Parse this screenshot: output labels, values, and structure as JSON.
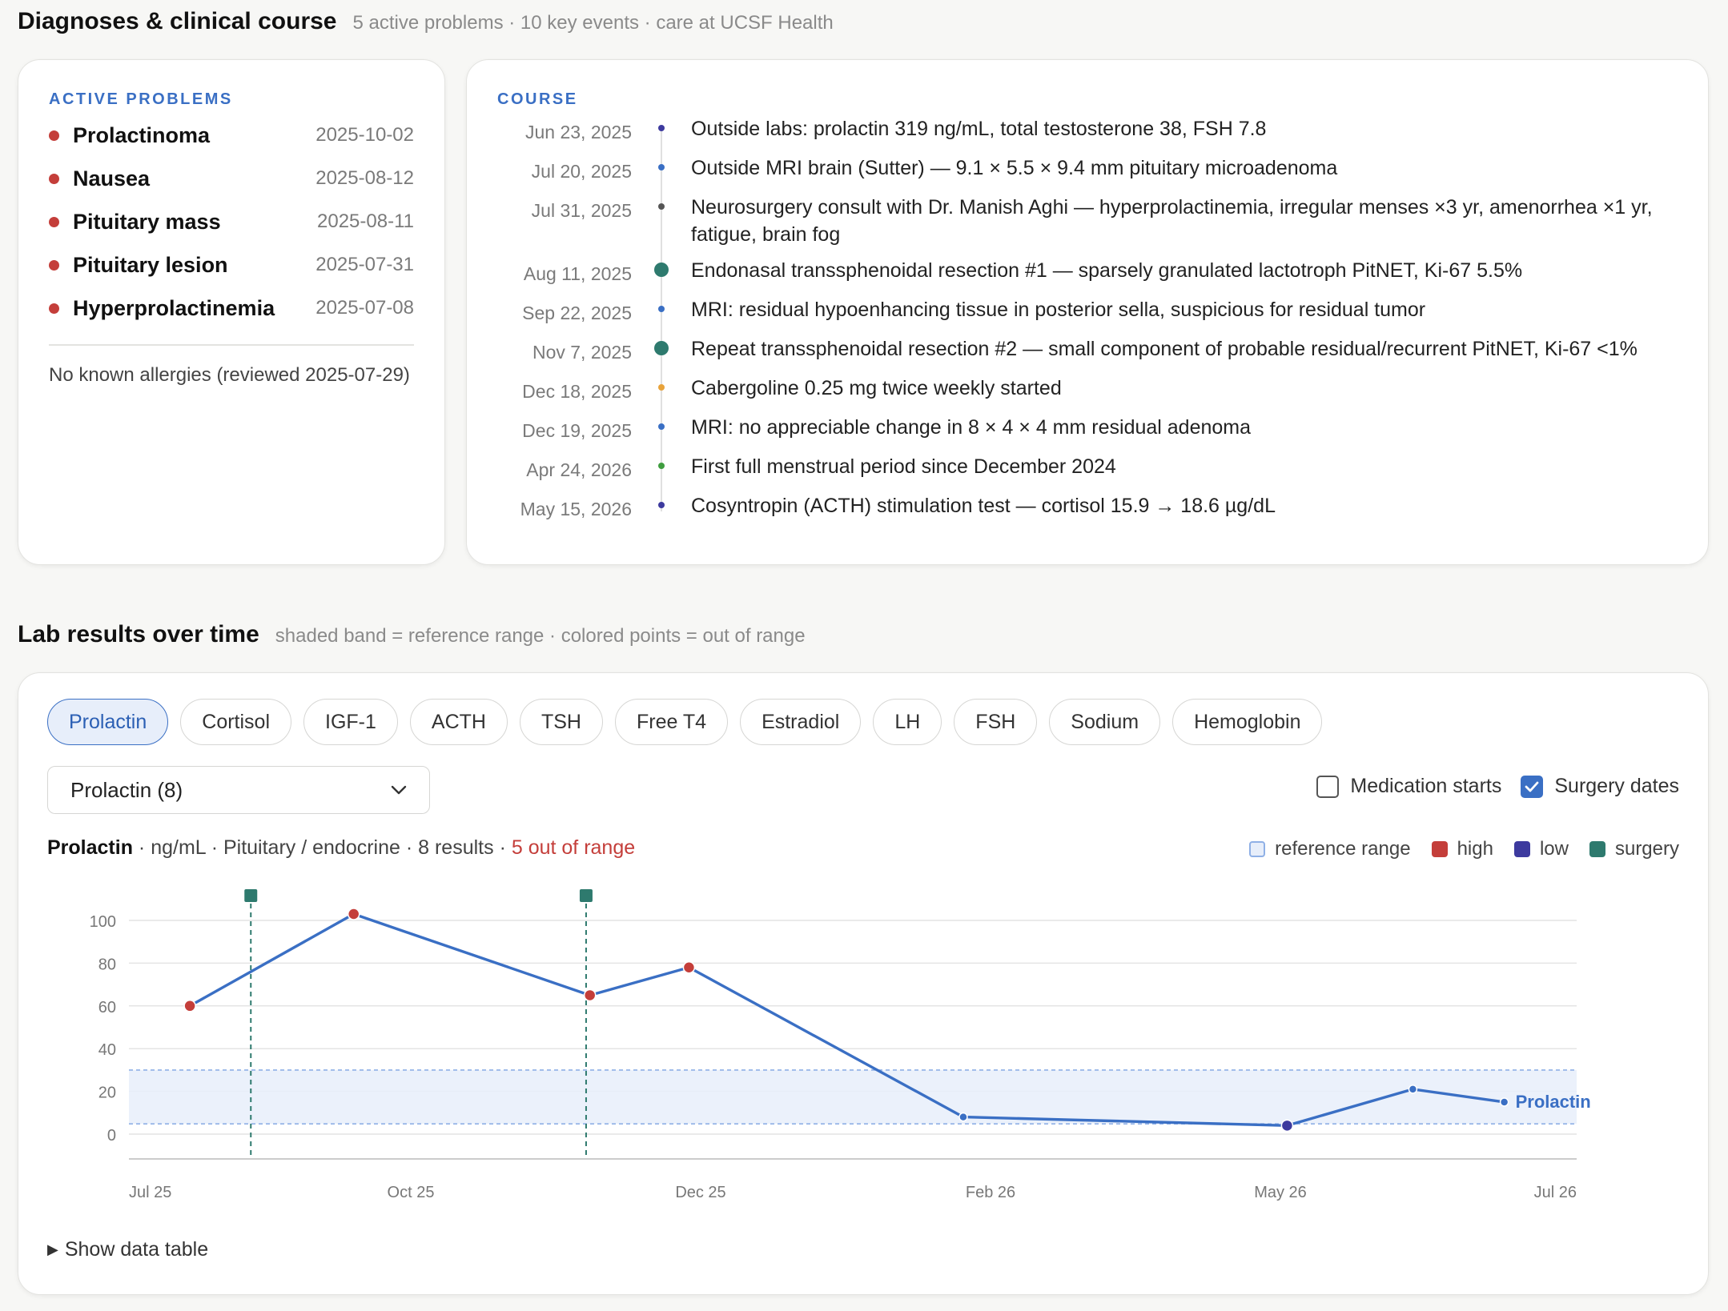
{
  "diagnoses": {
    "title": "Diagnoses & clinical course",
    "subtitle": "5 active problems · 10 key events · care at UCSF Health",
    "problems_label": "ACTIVE PROBLEMS",
    "problems": [
      {
        "name": "Prolactinoma",
        "date": "2025-10-02"
      },
      {
        "name": "Nausea",
        "date": "2025-08-12"
      },
      {
        "name": "Pituitary mass",
        "date": "2025-08-11"
      },
      {
        "name": "Pituitary lesion",
        "date": "2025-07-31"
      },
      {
        "name": "Hyperprolactinemia",
        "date": "2025-07-08"
      }
    ],
    "allergies": "No known allergies (reviewed 2025-07-29)",
    "course_label": "COURSE",
    "course": [
      {
        "date": "Jun 23, 2025",
        "text": "Outside labs: prolactin 319 ng/mL, total testosterone 38, FSH 7.8",
        "kind": "lab"
      },
      {
        "date": "Jul 20, 2025",
        "text": "Outside MRI brain (Sutter) — 9.1 × 5.5 × 9.4 mm pituitary microadenoma",
        "kind": "imaging"
      },
      {
        "date": "Jul 31, 2025",
        "text": "Neurosurgery consult with Dr. Manish Aghi — hyperprolactinemia, irregular menses ×3 yr, amenorrhea ×1 yr, fatigue, brain fog",
        "kind": "visit"
      },
      {
        "date": "Aug 11, 2025",
        "text": "Endonasal transsphenoidal resection #1 — sparsely granulated lactotroph PitNET, Ki-67 5.5%",
        "kind": "surgery"
      },
      {
        "date": "Sep 22, 2025",
        "text": "MRI: residual hypoenhancing tissue in posterior sella, suspicious for residual tumor",
        "kind": "imaging"
      },
      {
        "date": "Nov 7, 2025",
        "text": "Repeat transsphenoidal resection #2 — small component of probable residual/recurrent PitNET, Ki-67 <1%",
        "kind": "surgery"
      },
      {
        "date": "Dec 18, 2025",
        "text": "Cabergoline 0.25 mg twice weekly started",
        "kind": "medication"
      },
      {
        "date": "Dec 19, 2025",
        "text": "MRI: no appreciable change in 8 × 4 × 4 mm residual adenoma",
        "kind": "imaging"
      },
      {
        "date": "Apr 24, 2026",
        "text": "First full menstrual period since December 2024",
        "kind": "milestone"
      },
      {
        "date": "May 15, 2026",
        "text": "Cosyntropin (ACTH) stimulation test — cortisol 15.9 → 18.6 µg/dL",
        "kind": "lab"
      }
    ],
    "kind_colors": {
      "lab": "#3d3a9e",
      "imaging": "#3a6fc4",
      "visit": "#555555",
      "surgery": "#2e7a6e",
      "medication": "#e8a33b",
      "milestone": "#3f9d3f"
    }
  },
  "labs": {
    "title": "Lab results over time",
    "subtitle": "shaded band = reference range · colored points = out of range",
    "tabs": [
      "Prolactin",
      "Cortisol",
      "IGF-1",
      "ACTH",
      "TSH",
      "Free T4",
      "Estradiol",
      "LH",
      "FSH",
      "Sodium",
      "Hemoglobin"
    ],
    "active_tab": "Prolactin",
    "select_value": "Prolactin (8)",
    "chevron_icon": "chevron-down-icon",
    "toggles": [
      {
        "label": "Medication starts",
        "checked": false
      },
      {
        "label": "Surgery dates",
        "checked": true
      }
    ],
    "meta": {
      "analyte": "Prolactin",
      "details": " · ng/mL · Pituitary / endocrine · 8 results · ",
      "out_of_range": "5 out of range"
    },
    "legend": [
      {
        "label": "reference range",
        "key": "ref"
      },
      {
        "label": "high",
        "key": "high"
      },
      {
        "label": "low",
        "key": "low"
      },
      {
        "label": "surgery",
        "key": "surgery"
      }
    ],
    "colors": {
      "line": "#3a6fc4",
      "high": "#c43e3a",
      "low": "#3d3a9e",
      "surgery": "#2e7a6e",
      "band": "#e7eefa",
      "band_edge": "#8fb0e6"
    },
    "show_table": "Show data table"
  },
  "chart_data": {
    "type": "line",
    "series": [
      {
        "name": "Prolactin",
        "points": [
          {
            "x": "2025-07-26",
            "y": 60,
            "flag": "high"
          },
          {
            "x": "2025-09-07",
            "y": 103,
            "flag": "high"
          },
          {
            "x": "2025-11-08",
            "y": 65,
            "flag": "high"
          },
          {
            "x": "2025-12-04",
            "y": 78,
            "flag": "high"
          },
          {
            "x": "2026-02-14",
            "y": 8,
            "flag": "normal"
          },
          {
            "x": "2026-05-10",
            "y": 4,
            "flag": "low"
          },
          {
            "x": "2026-06-12",
            "y": 21,
            "flag": "normal"
          },
          {
            "x": "2026-07-06",
            "y": 15,
            "flag": "normal"
          }
        ]
      }
    ],
    "reference_range": [
      4.8,
      30
    ],
    "surgery_dates": [
      "2025-08-11",
      "2025-11-07"
    ],
    "ylim": [
      0,
      110
    ],
    "yticks": [
      0,
      20,
      40,
      60,
      80,
      100
    ],
    "xlim": [
      "2025-07-01",
      "2026-07-31"
    ],
    "xticks": [
      {
        "date": "2025-07-01",
        "label": "Jul 25"
      },
      {
        "date": "2025-10-01",
        "label": "Oct 25"
      },
      {
        "date": "2026-01-01",
        "label": "Dec 25"
      },
      {
        "date": "2026-04-01",
        "label": "Feb 26"
      },
      {
        "date": "2026-07-01",
        "label": "May 26"
      },
      {
        "date": "2026-10-01",
        "label": "Jul 26"
      }
    ],
    "grid": true,
    "xlabel": "",
    "ylabel": ""
  }
}
